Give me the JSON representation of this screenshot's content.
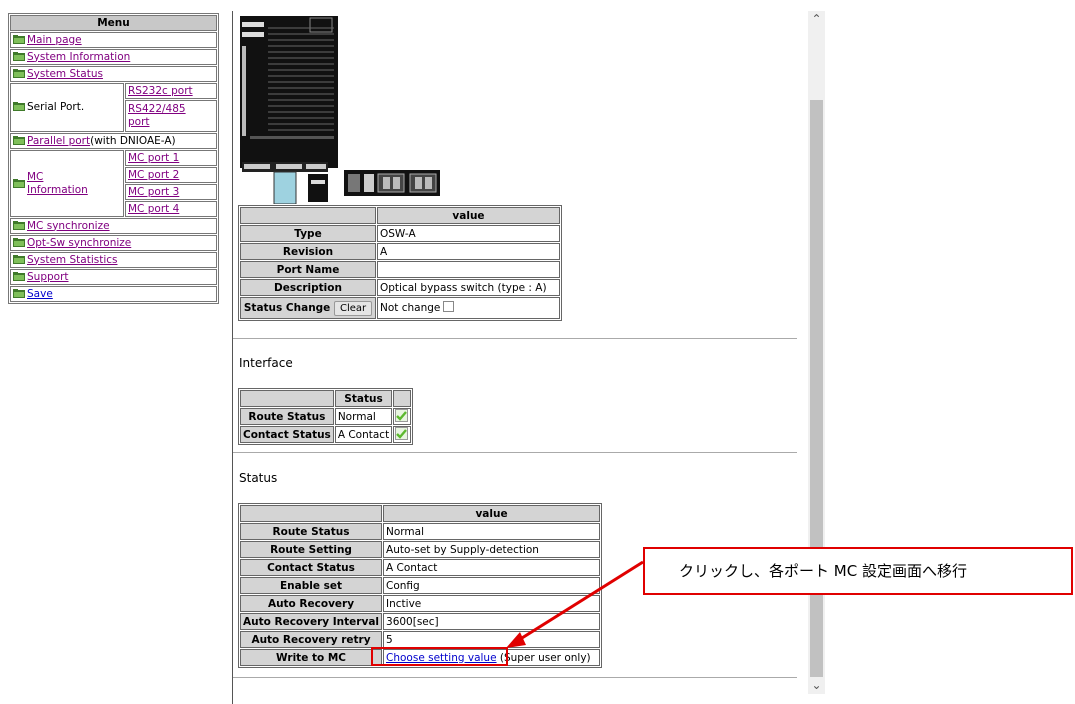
{
  "menu": {
    "header": "Menu",
    "main_page": "Main page",
    "system_information": "System Information",
    "system_status": "System Status",
    "serial_port": "Serial Port.",
    "rs232c": "RS232c port",
    "rs422_1": "RS422/485",
    "rs422_2": "port",
    "parallel_port": "Parallel port",
    "parallel_suffix": "(with DNIOAE-A)",
    "mc_info_1": "MC",
    "mc_info_2": "Information",
    "mc_port_1": "MC port 1",
    "mc_port_2": "MC port 2",
    "mc_port_3": "MC port 3",
    "mc_port_4": "MC port 4",
    "mc_sync": "MC synchronize",
    "optsw_sync": "Opt-Sw synchronize",
    "system_statistics": "System Statistics",
    "support": "Support",
    "save": "Save"
  },
  "device_table": {
    "value_header": "value",
    "type_label": "Type",
    "type_value": "OSW-A",
    "revision_label": "Revision",
    "revision_value": "A",
    "port_name_label": "Port Name",
    "port_name_value": "",
    "description_label": "Description",
    "description_value": "Optical bypass switch (type : A)",
    "status_change_label": "Status Change",
    "clear_button": "Clear",
    "not_change": "Not change"
  },
  "interface": {
    "title": "Interface",
    "status_header": "Status",
    "route_status_label": "Route Status",
    "route_status_value": "Normal",
    "contact_status_label": "Contact Status",
    "contact_status_value": "A Contact"
  },
  "status": {
    "title": "Status",
    "value_header": "value",
    "rows": [
      {
        "label": "Route Status",
        "value": "Normal"
      },
      {
        "label": "Route Setting",
        "value": "Auto-set by Supply-detection"
      },
      {
        "label": "Contact Status",
        "value": "A Contact"
      },
      {
        "label": "Enable set",
        "value": "Config"
      },
      {
        "label": "Auto Recovery",
        "value": "Inctive"
      },
      {
        "label": "Auto Recovery Interval",
        "value": "3600[sec]"
      },
      {
        "label": "Auto Recovery retry",
        "value": "5"
      }
    ],
    "write_label": "Write to MC",
    "write_link": "Choose setting value",
    "write_suffix": "(Super user only)"
  },
  "annotation": {
    "text": "クリックし、各ポート MC 設定画面へ移行"
  },
  "colors": {
    "annotation_red": "#e00000",
    "link": "#0000cc",
    "visited": "#800080",
    "folder": "#3f7a2a",
    "ok_green": "#5cb82e"
  }
}
